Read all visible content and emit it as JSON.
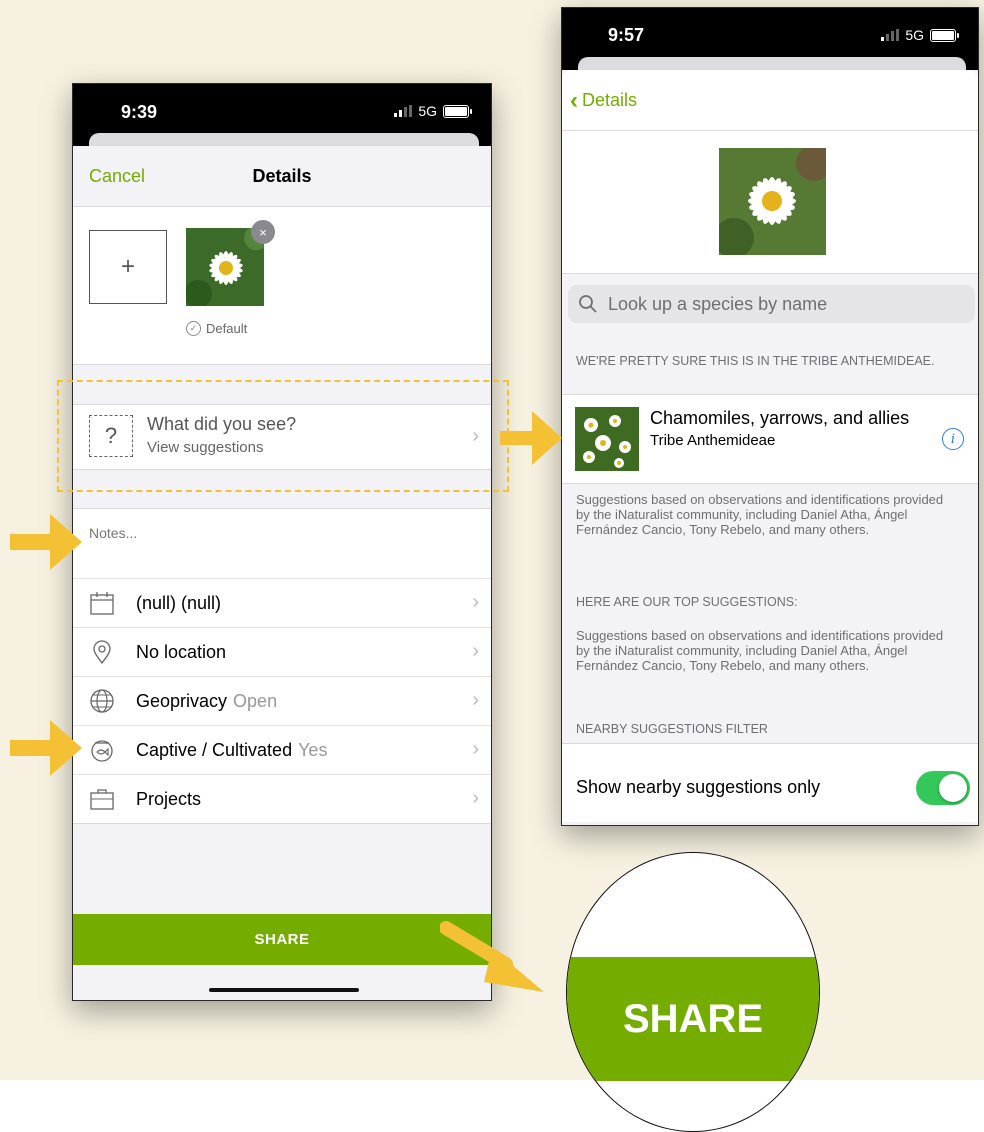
{
  "left_phone": {
    "status": {
      "time": "9:39",
      "network": "5G"
    },
    "nav": {
      "cancel": "Cancel",
      "title": "Details"
    },
    "photos": {
      "add_symbol": "+",
      "remove_symbol": "×",
      "default_label": "Default"
    },
    "what_did_you_see": {
      "title": "What did you see?",
      "subtitle": "View suggestions"
    },
    "notes_placeholder": "Notes...",
    "rows": [
      {
        "icon": "calendar-icon",
        "label": "(null) (null)",
        "value": ""
      },
      {
        "icon": "location-pin-icon",
        "label": "No location",
        "value": ""
      },
      {
        "icon": "globe-icon",
        "label": "Geoprivacy",
        "value": "Open"
      },
      {
        "icon": "fishbowl-icon",
        "label": "Captive / Cultivated",
        "value": "Yes"
      },
      {
        "icon": "briefcase-icon",
        "label": "Projects",
        "value": ""
      }
    ],
    "share": "SHARE"
  },
  "right_phone": {
    "status": {
      "time": "9:57",
      "network": "5G"
    },
    "nav": {
      "back": "Details"
    },
    "search_placeholder": "Look up a species by name",
    "pretty_sure_header": "WE'RE PRETTY SURE THIS IS IN THE TRIBE ANTHEMIDEAE.",
    "suggestion": {
      "name": "Chamomiles, yarrows, and allies",
      "rank": "Tribe Anthemideae"
    },
    "credits_1": "Suggestions based on observations and identifications provided by the iNaturalist community, including Daniel Atha, Ángel Fernández Cancio, Tony Rebelo, and many others.",
    "top_header": "HERE ARE OUR TOP SUGGESTIONS:",
    "credits_2": "Suggestions based on observations and identifications provided by the iNaturalist community, including Daniel Atha, Ángel Fernández Cancio, Tony Rebelo, and many others.",
    "nearby_header": "NEARBY SUGGESTIONS FILTER",
    "nearby_label": "Show nearby suggestions only",
    "nearby_on": true
  },
  "zoom": {
    "label": "SHARE"
  },
  "colors": {
    "brand_green": "#74ac00",
    "highlight_yellow": "#f4c034",
    "background": "#f6f1e1",
    "toggle_on": "#34c759",
    "info_blue": "#2f7fd8"
  }
}
